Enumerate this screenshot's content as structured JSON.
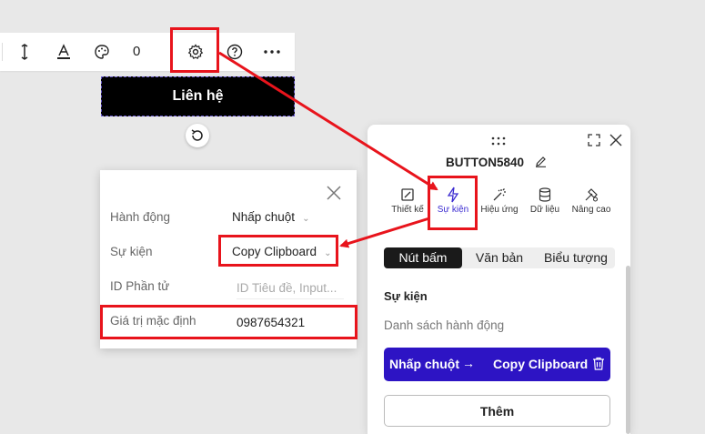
{
  "toolbar": {
    "count": "0",
    "icons": [
      "text-height-icon",
      "text-color-icon",
      "palette-icon",
      "settings-gear-icon",
      "help-icon",
      "more-icon"
    ]
  },
  "canvas": {
    "button_text": "Liên hệ"
  },
  "popup": {
    "rows": [
      {
        "label": "Hành động",
        "value": "Nhấp chuột"
      },
      {
        "label": "Sự kiện",
        "value": "Copy Clipboard"
      },
      {
        "label": "ID Phần tử",
        "placeholder": "ID Tiêu đề, Input..."
      },
      {
        "label": "Giá trị mặc định",
        "value": "0987654321"
      }
    ]
  },
  "panel": {
    "title": "BUTTON5840",
    "tabs": [
      {
        "label": "Thiết kế",
        "icon": "design-icon"
      },
      {
        "label": "Sự kiện",
        "icon": "lightning-icon",
        "active": true
      },
      {
        "label": "Hiệu ứng",
        "icon": "magic-wand-icon"
      },
      {
        "label": "Dữ liệu",
        "icon": "database-icon"
      },
      {
        "label": "Nâng cao",
        "icon": "advanced-icon"
      }
    ],
    "segments": [
      "Nút bấm",
      "Văn bản",
      "Biểu tượng"
    ],
    "section_title": "Sự kiện",
    "section_subtitle": "Danh sách hành động",
    "action": {
      "trigger": "Nhấp chuột",
      "arrow": "→",
      "result": "Copy Clipboard"
    },
    "add_label": "Thêm"
  },
  "colors": {
    "highlight": "#e8141c",
    "accent": "#2d14c4",
    "active_tab": "#3b2bd1"
  }
}
